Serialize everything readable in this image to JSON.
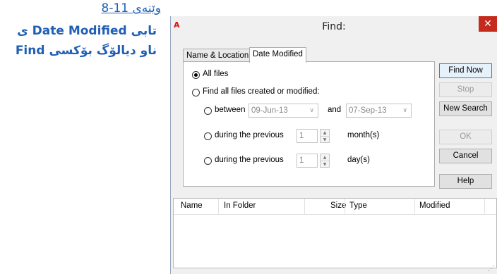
{
  "caption": {
    "number": "وێنەی 11-8",
    "line1": "تابی Date Modified ی",
    "line2": "ناو دیالۆگ بۆکسی Find"
  },
  "window": {
    "icon_text": "A",
    "title": "Find:",
    "close_glyph": "✕"
  },
  "tabs": [
    {
      "label": "Name & Location",
      "active": false
    },
    {
      "label": "Date Modified",
      "active": true
    }
  ],
  "options": {
    "all_files": "All files",
    "find_all": "Find all files created or modified:",
    "between": "between",
    "and": "and",
    "date_from": "09-Jun-13",
    "date_to": "07-Sep-13",
    "during_months": "during the previous",
    "months_value": "1",
    "months_unit": "month(s)",
    "during_days": "during the previous",
    "days_value": "1",
    "days_unit": "day(s)"
  },
  "buttons": {
    "find_now": "Find Now",
    "stop": "Stop",
    "new_search": "New Search",
    "ok": "OK",
    "cancel": "Cancel",
    "help": "Help"
  },
  "results": {
    "columns": [
      "Name",
      "In Folder",
      "Size",
      "Type",
      "Modified"
    ]
  },
  "icons": {
    "dropdown": "chevron-down-icon",
    "spin_up": "arrow-up-icon",
    "spin_down": "arrow-down-icon",
    "close": "close-icon"
  },
  "colors": {
    "caption": "#1f5fb4",
    "close_button": "#c42b1c",
    "default_button_border": "#3c7fb1"
  }
}
